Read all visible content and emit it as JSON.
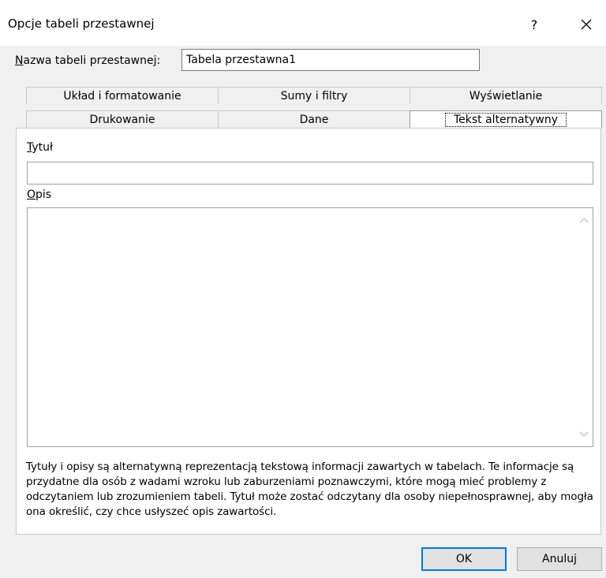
{
  "dialog": {
    "title": "Opcje tabeli przestawnej",
    "help_label": "?",
    "close_icon": "close-icon"
  },
  "name": {
    "label_access_key": "N",
    "label_rest": "azwa tabeli przestawnej:",
    "value": "Tabela przestawna1"
  },
  "tabs": {
    "back_row": [
      "Układ i formatowanie",
      "Sumy i filtry",
      "Wyświetlanie"
    ],
    "front_row": [
      "Drukowanie",
      "Dane",
      "Tekst alternatywny"
    ],
    "active": "Tekst alternatywny"
  },
  "alt_text": {
    "title_label_access_key": "T",
    "title_label_rest": "ytuł",
    "title_value": "",
    "description_label_access_key": "O",
    "description_label_rest": "pis",
    "description_value": "",
    "help_text": "Tytuły i opisy są alternatywną reprezentacją tekstową informacji zawartych w tabelach. Te informacje są przydatne dla osób z wadami wzroku lub zaburzeniami poznawczymi, które mogą mieć problemy z odczytaniem lub zrozumieniem tabeli. Tytuł może zostać odczytany dla osoby niepełnosprawnej, aby mogła ona określić, czy chce usłyszeć opis zawartości."
  },
  "buttons": {
    "ok": "OK",
    "cancel": "Anuluj"
  }
}
